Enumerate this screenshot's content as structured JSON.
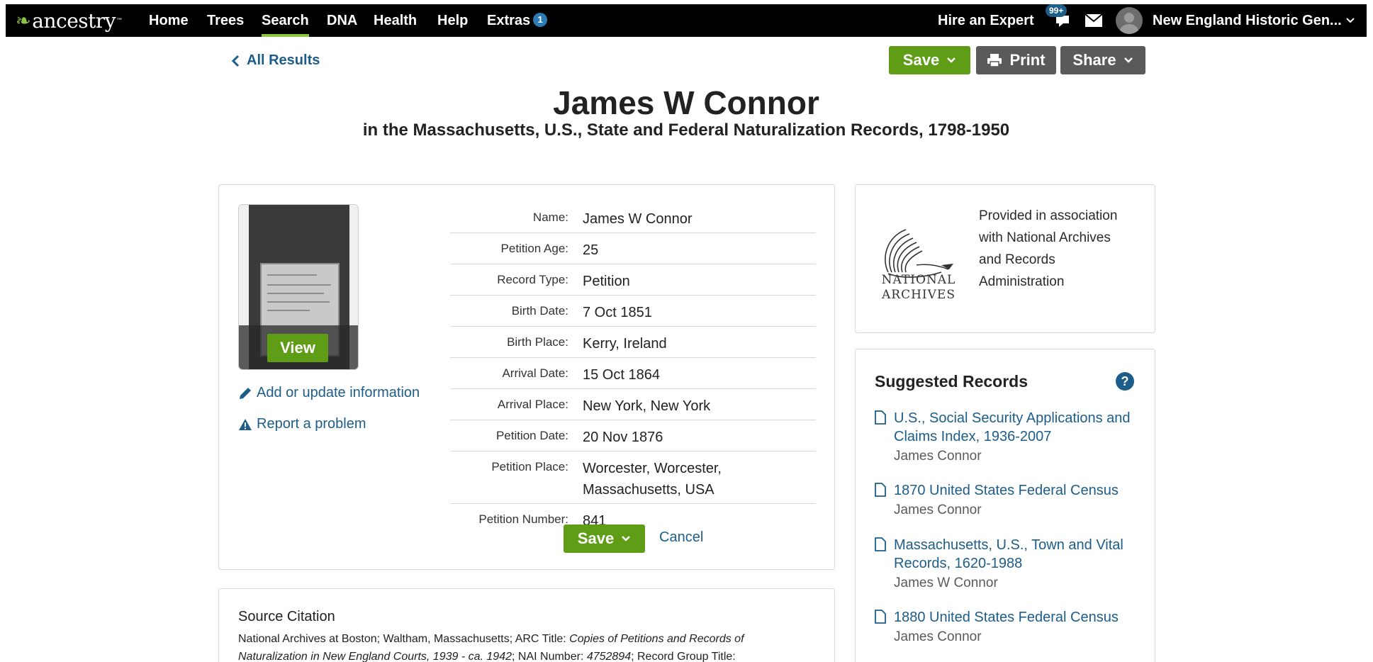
{
  "nav": {
    "logo": "ancestry",
    "items": [
      "Home",
      "Trees",
      "Search",
      "DNA",
      "Health",
      "Help",
      "Extras"
    ],
    "active": "Search",
    "extras_badge": "1",
    "hire_expert": "Hire an Expert",
    "notifications_badge": "99+",
    "account": "New England Historic Gen...",
    "accent_color": "#8cc63f"
  },
  "header": {
    "back_link": "All Results",
    "save_label": "Save",
    "print_label": "Print",
    "share_label": "Share",
    "title": "James W Connor",
    "subtitle": "in the Massachusetts, U.S., State and Federal Naturalization Records, 1798-1950"
  },
  "record": {
    "view_label": "View",
    "add_update_label": "Add or update information",
    "report_label": "Report a problem",
    "facts": [
      {
        "label": "Name:",
        "value": "James W Connor"
      },
      {
        "label": "Petition Age:",
        "value": "25"
      },
      {
        "label": "Record Type:",
        "value": "Petition"
      },
      {
        "label": "Birth Date:",
        "value": "7 Oct 1851"
      },
      {
        "label": "Birth Place:",
        "value": "Kerry, Ireland"
      },
      {
        "label": "Arrival Date:",
        "value": "15 Oct 1864"
      },
      {
        "label": "Arrival Place:",
        "value": "New York, New York"
      },
      {
        "label": "Petition Date:",
        "value": "20 Nov 1876"
      },
      {
        "label": "Petition Place:",
        "value": "Worcester, Worcester, Massachusetts, USA"
      },
      {
        "label": "Petition Number:",
        "value": "841"
      }
    ],
    "save_label": "Save",
    "cancel_label": "Cancel"
  },
  "partner": {
    "logo_text_line1": "NATIONAL",
    "logo_text_line2": "ARCHIVES",
    "text": "Provided in association with National Archives and Records Administration"
  },
  "suggested": {
    "title": "Suggested Records",
    "items": [
      {
        "title": "U.S., Social Security Applications and Claims Index, 1936-2007",
        "name": "James Connor"
      },
      {
        "title": "1870 United States Federal Census",
        "name": "James Connor"
      },
      {
        "title": "Massachusetts, U.S., Town and Vital Records, 1620-1988",
        "name": "James W Connor"
      },
      {
        "title": "1880 United States Federal Census",
        "name": "James Connor"
      }
    ]
  },
  "citation": {
    "title": "Source Citation",
    "text_a": "National Archives at Boston; Waltham, Massachusetts; ARC Title: ",
    "text_b": "Copies of Petitions and Records of Naturalization in New England Courts, 1939 - ca. 1942",
    "text_c": "; NAI Number: ",
    "text_d": "4752894",
    "text_e": "; Record Group Title:"
  }
}
